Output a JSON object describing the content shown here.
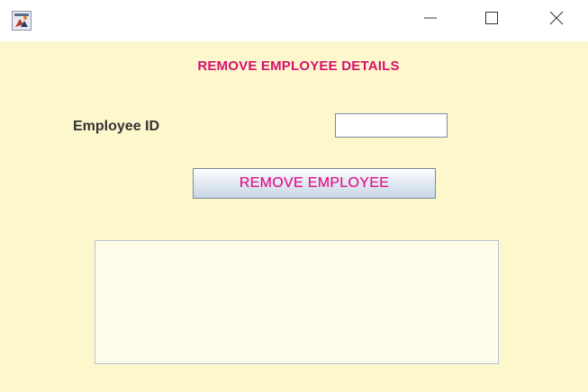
{
  "window": {
    "icon": "java-app-icon",
    "controls": {
      "minimize_icon": "minimize-icon",
      "maximize_icon": "maximize-icon",
      "close_icon": "close-icon"
    }
  },
  "form": {
    "heading": "REMOVE EMPLOYEE DETAILS",
    "employee_id_label": "Employee ID",
    "employee_id_value": "",
    "remove_button_label": "REMOVE EMPLOYEE",
    "output_text": ""
  },
  "colors": {
    "background": "#fdf7cc",
    "accent": "#d6106e",
    "button_text": "#e0148a"
  }
}
